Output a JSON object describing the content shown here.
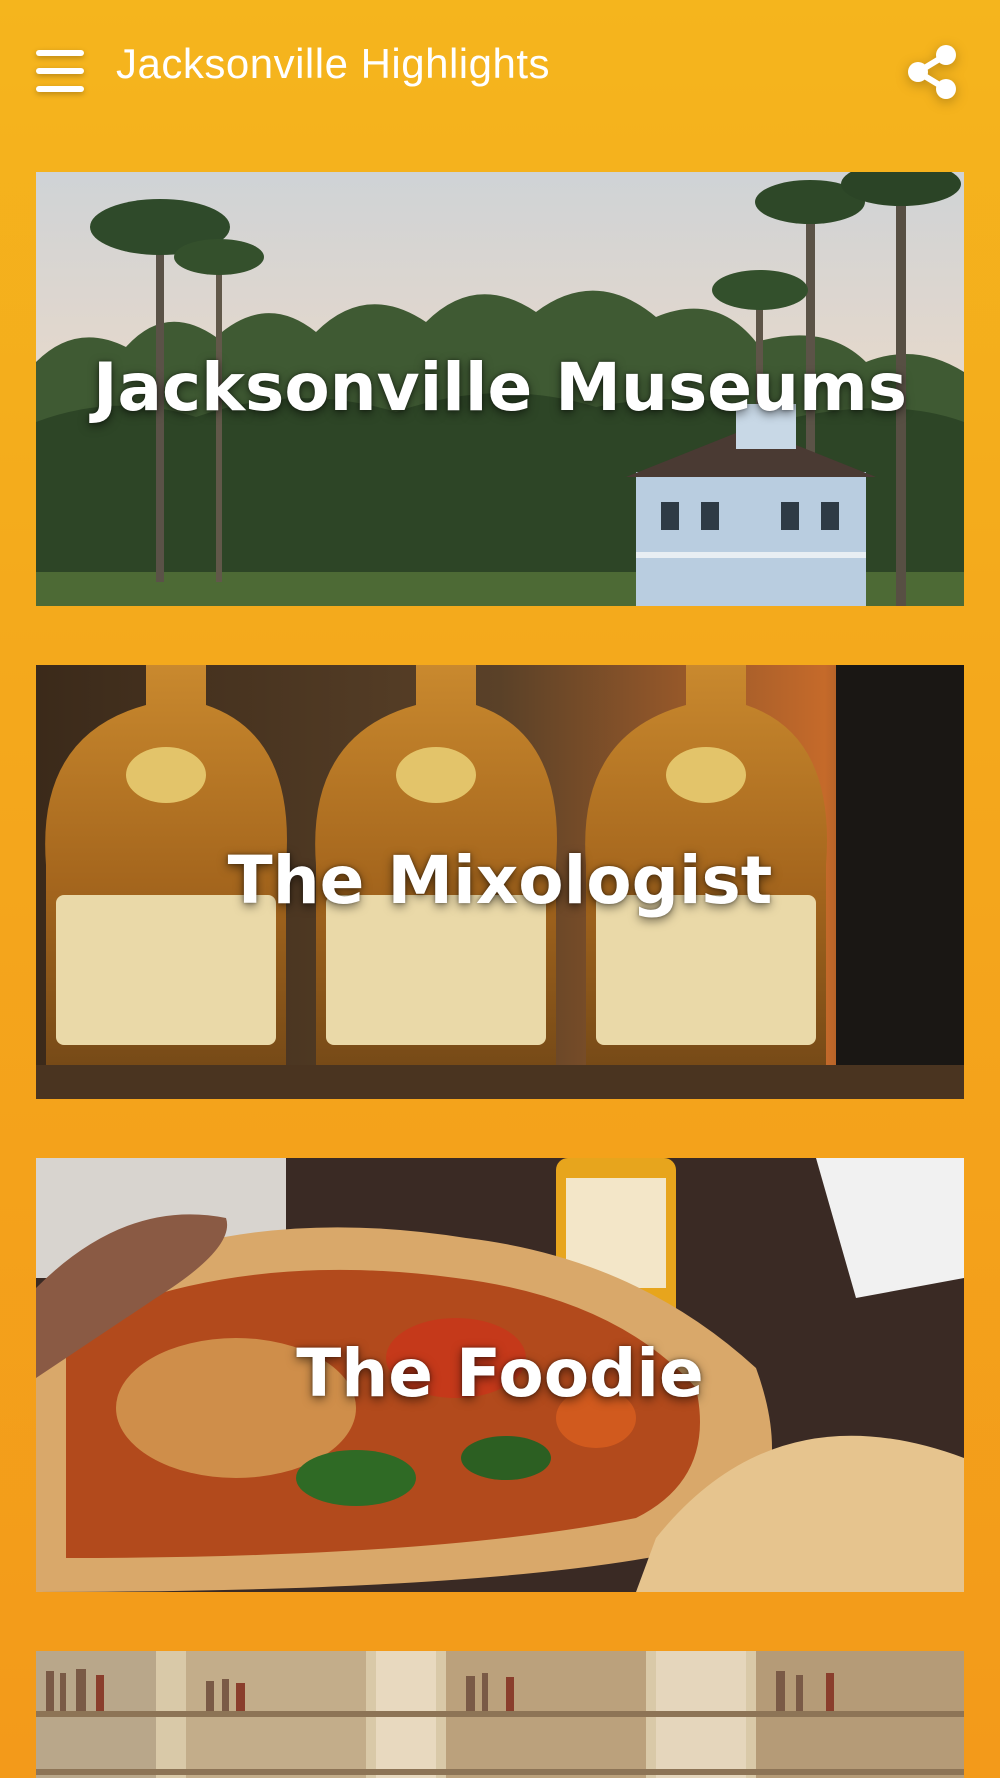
{
  "header": {
    "title": "Jacksonville Highlights",
    "menu_icon": "menu-icon",
    "share_icon": "share-icon"
  },
  "cards": [
    {
      "title": "Jacksonville Museums",
      "image": "palm-trees-and-plantation-house"
    },
    {
      "title": "The Mixologist",
      "image": "whiskey-bottles"
    },
    {
      "title": "The Foodie",
      "image": "burrito-with-hot-sauce"
    },
    {
      "title": "",
      "image": "bookstore-shelves"
    }
  ],
  "colors": {
    "background": "#f5b51d",
    "text": "#ffffff"
  }
}
